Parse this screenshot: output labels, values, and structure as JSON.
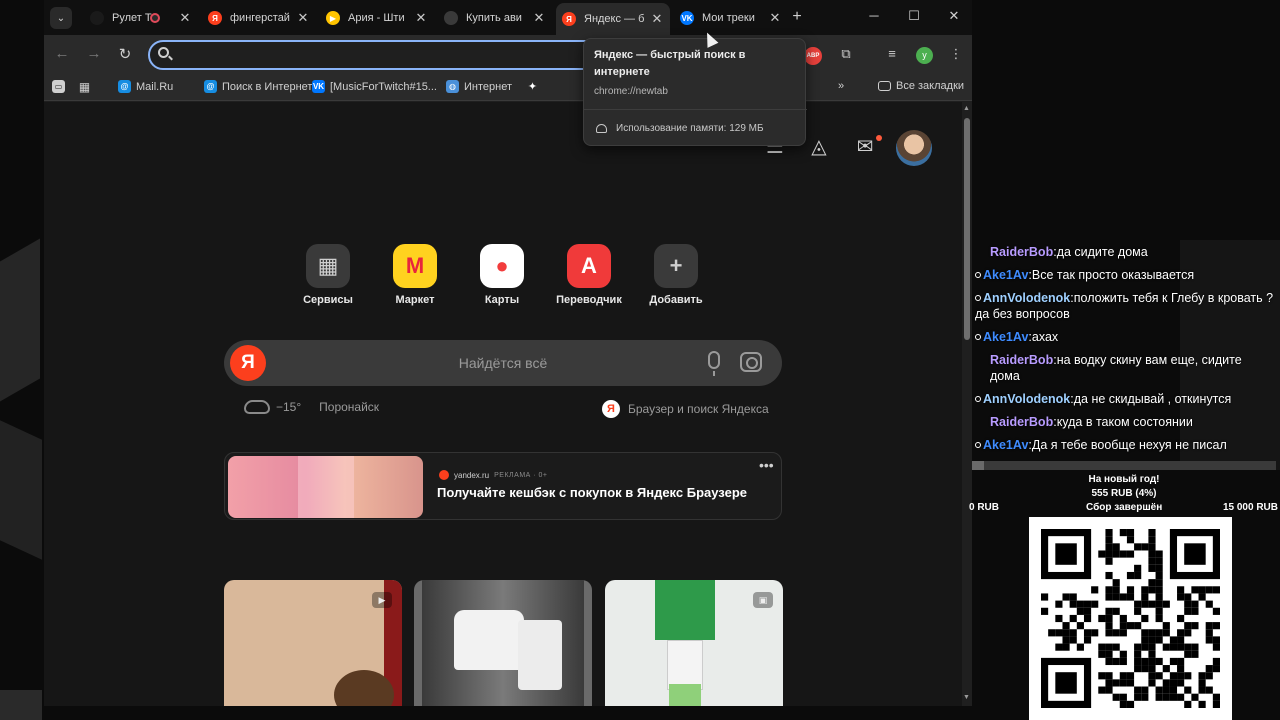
{
  "tabs": [
    {
      "label": "Рулет Т",
      "favicon": "tiktok-icon",
      "color": "#1a1a1a",
      "sound": true
    },
    {
      "label": "фингерстай",
      "favicon": "yandex-icon",
      "color": "#fc3f1d"
    },
    {
      "label": "Ария - Шти",
      "favicon": "play-icon",
      "color": "#ffc400"
    },
    {
      "label": "Купить ави",
      "favicon": "ticket-icon",
      "color": "#3a3a3a"
    },
    {
      "label": "Яндекс — б",
      "favicon": "yandex-icon",
      "color": "#fc3f1d",
      "active": true
    },
    {
      "label": "Мои треки",
      "favicon": "vk-icon",
      "color": "#0077ff"
    }
  ],
  "toolbar": {
    "address_value": "",
    "extensions": [
      "ABP"
    ]
  },
  "bookmarks": [
    {
      "label": "Mail.Ru",
      "icon": "at-icon",
      "color": "#168de2"
    },
    {
      "label": "Поиск в Интернете",
      "icon": "at-icon",
      "color": "#168de2"
    },
    {
      "label": "[MusicForTwitch#15...",
      "icon": "vk-icon",
      "color": "#0077ff"
    },
    {
      "label": "Интернет",
      "icon": "globe-icon",
      "color": "#4a90d9"
    },
    {
      "label": "",
      "icon": "sparkle-icon",
      "color": "#ffffff"
    }
  ],
  "bookmarks_all": "Все закладки",
  "tooltip": {
    "title": "Яндекс — быстрый поиск в интернете",
    "url": "chrome://newtab",
    "memory": "Использование памяти: 129 МБ"
  },
  "services": [
    {
      "label": "Сервисы",
      "icon": "grid-icon",
      "bg": "#3a3a3a",
      "fg": "#cfcfcf",
      "glyph": "▦"
    },
    {
      "label": "Маркет",
      "icon": "market-icon",
      "bg": "#ffd21f",
      "fg": "#e8243c",
      "glyph": "М"
    },
    {
      "label": "Карты",
      "icon": "map-pin-icon",
      "bg": "#ffffff",
      "fg": "#f23c3c",
      "glyph": "●"
    },
    {
      "label": "Переводчик",
      "icon": "translate-icon",
      "bg": "#f03a3a",
      "fg": "#ffffff",
      "glyph": "A"
    },
    {
      "label": "Добавить",
      "icon": "plus-icon",
      "bg": "#3a3a3a",
      "fg": "#cfcfcf",
      "glyph": "+"
    }
  ],
  "search": {
    "logo": "Я",
    "placeholder": "Найдётся всё"
  },
  "weather": {
    "temp": "−15°",
    "city": "Поронайск"
  },
  "byline": {
    "logo": "Я",
    "text": "Браузер и поиск Яндекса"
  },
  "promo": {
    "source": "yandex.ru",
    "ad_label": "РЕКЛАМА · 0+",
    "title": "Получайте кешбэк с покупок в Яндекс Браузере"
  },
  "cards": [
    {
      "badge": "▶",
      "bg": "#d9b89a"
    },
    {
      "badge": "",
      "bg": "#6a6a6a"
    },
    {
      "badge": "▣",
      "bg": "#e9ecea"
    }
  ],
  "chat": [
    {
      "nick": "RaiderBob",
      "cls": "nick-raider",
      "text": "да сидите дома",
      "bullet": false
    },
    {
      "nick": "Ake1Av",
      "cls": "nick-ake",
      "text": "Все так просто оказывается",
      "bullet": true
    },
    {
      "nick": "AnnVolodenok",
      "cls": "nick-ann",
      "text": "положить тебя к Глебу в кровать ? да без вопросов",
      "bullet": true
    },
    {
      "nick": "Ake1Av",
      "cls": "nick-ake",
      "text": "ахах",
      "bullet": true
    },
    {
      "nick": "RaiderBob",
      "cls": "nick-raider",
      "text": "на водку скину вам еще, сидите дома",
      "bullet": false
    },
    {
      "nick": "AnnVolodenok",
      "cls": "nick-ann",
      "text": "да не скидывай , откинутся",
      "bullet": true
    },
    {
      "nick": "RaiderBob",
      "cls": "nick-raider",
      "text": "куда в таком состоянии",
      "bullet": false
    },
    {
      "nick": "Ake1Av",
      "cls": "nick-ake",
      "text": "Да я тебе вообще нехуя не писал",
      "bullet": true
    }
  ],
  "goal": {
    "title": "На новый год!",
    "amount": "555 RUB (4%)",
    "progress_percent": 4,
    "min": "0 RUB",
    "status": "Сбор завершён",
    "max": "15 000 RUB"
  }
}
